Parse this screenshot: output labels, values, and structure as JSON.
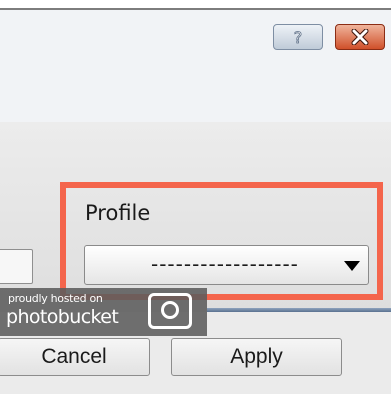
{
  "titlebar": {
    "help_icon": "question-mark-icon",
    "close_icon": "close-x-icon",
    "help_glyph": "?"
  },
  "profile": {
    "label": "Profile",
    "selected_value": "------------------"
  },
  "watermark": {
    "line1": "proudly hosted on",
    "line2": "photobucket",
    "icon": "camera-icon"
  },
  "footer": {
    "cancel_label": "Cancel",
    "apply_label": "Apply"
  },
  "colors": {
    "highlight": "#f4654c",
    "close_button": "#d0502a",
    "help_button": "#bfcbd8"
  }
}
